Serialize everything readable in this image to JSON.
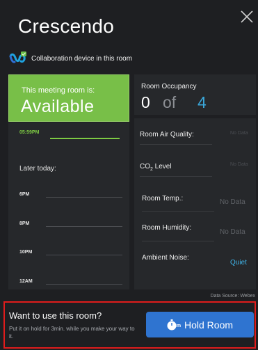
{
  "header": {
    "room_name": "Crescendo",
    "close_icon": "close-icon",
    "device_logo_icon": "webex-logo-icon",
    "device_text": "Collaboration device in this room"
  },
  "status": {
    "line1": "This meeting room is:",
    "line2": "Available",
    "color": "#78bf48"
  },
  "schedule": {
    "now_time": "05:59PM",
    "later_label": "Later today:",
    "times": [
      "6PM",
      "8PM",
      "10PM",
      "12AM"
    ]
  },
  "occupancy": {
    "label": "Room Occupancy",
    "current": "0",
    "of_text": "of",
    "capacity": "4",
    "capacity_color": "#3aa7d9"
  },
  "metrics": [
    {
      "label": "Room Air Quality:",
      "value": "No Data"
    },
    {
      "label": "CO",
      "label_sub": "2",
      "label_rest": " Level",
      "value": "No Data"
    },
    {
      "label": "Room Temp.:",
      "value": "No Data"
    },
    {
      "label": "Room Humidity:",
      "value": "No Data"
    },
    {
      "label": "Ambient Noise:",
      "value": "Quiet"
    }
  ],
  "data_source": "Data Source: Webex",
  "hold": {
    "title": "Want to use this room?",
    "description": "Put it on hold for 3min. while you make your way to it.",
    "button_label": "Hold Room",
    "button_icon": "timer-icon",
    "timer_sub": "3m",
    "button_color": "#2f74d0"
  }
}
